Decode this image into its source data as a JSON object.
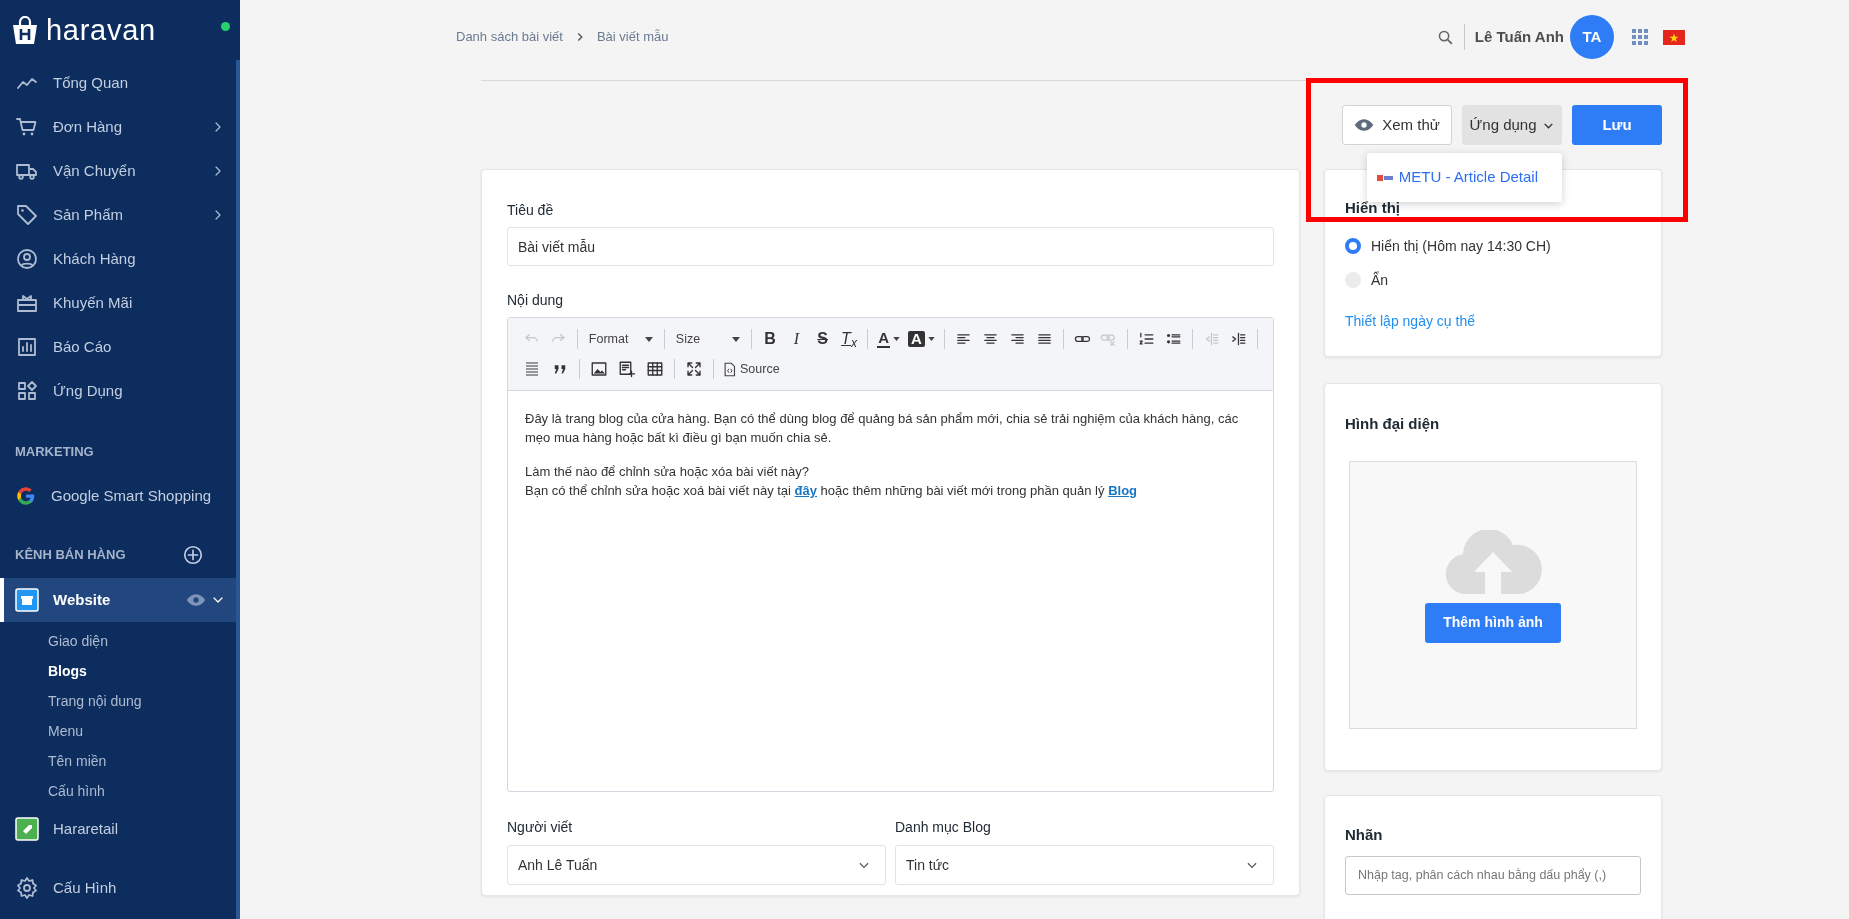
{
  "sidebar": {
    "logo_text": "haravan",
    "online": true,
    "nav_items": [
      {
        "label": "Tổng Quan",
        "has_submenu": false
      },
      {
        "label": "Đơn Hàng",
        "has_submenu": true
      },
      {
        "label": "Vận Chuyển",
        "has_submenu": true
      },
      {
        "label": "Sản Phẩm",
        "has_submenu": true
      },
      {
        "label": "Khách Hàng",
        "has_submenu": false
      },
      {
        "label": "Khuyến Mãi",
        "has_submenu": false
      },
      {
        "label": "Báo Cáo",
        "has_submenu": false
      },
      {
        "label": "Ứng Dụng",
        "has_submenu": false
      }
    ],
    "marketing": {
      "heading": "MARKETING",
      "items": [
        {
          "label": "Google Smart Shopping"
        }
      ]
    },
    "sales_channels": {
      "heading": "KÊNH BÁN HÀNG",
      "channels": [
        {
          "label": "Website",
          "selected": true,
          "expanded": true,
          "children": [
            {
              "label": "Giao diện",
              "selected": false
            },
            {
              "label": "Blogs",
              "selected": true
            },
            {
              "label": "Trang nội dung",
              "selected": false
            },
            {
              "label": "Menu",
              "selected": false
            },
            {
              "label": "Tên miền",
              "selected": false
            },
            {
              "label": "Cấu hình",
              "selected": false
            }
          ]
        },
        {
          "label": "Hararetail",
          "selected": false,
          "expanded": false
        }
      ]
    },
    "footer_item": {
      "label": "Cấu Hình"
    }
  },
  "header": {
    "breadcrumb": [
      "Danh sách bài viết",
      "Bài viết mẫu"
    ],
    "user_name": "Lê Tuấn Anh",
    "avatar_initials": "TA"
  },
  "actions": {
    "preview_button": "Xem thử",
    "apps_button": "Ứng dụng",
    "save_button": "Lưu",
    "apps_menu": {
      "open": true,
      "items": [
        {
          "label": "METU - Article Detail"
        }
      ]
    }
  },
  "article": {
    "title_label": "Tiêu đề",
    "title_value": "Bài viết mẫu",
    "content_label": "Nội dung",
    "toolbar_rows": [
      [
        {
          "kind": "icon",
          "disabled": true
        },
        {
          "kind": "icon",
          "disabled": true
        },
        {
          "kind": "separator"
        },
        {
          "kind": "menu",
          "label": "Format"
        },
        {
          "kind": "separator"
        },
        {
          "kind": "menu",
          "label": "Size"
        },
        {
          "kind": "separator"
        },
        {
          "kind": "bold",
          "label": "B"
        },
        {
          "kind": "italic",
          "label": "I"
        },
        {
          "kind": "strike",
          "label": "S"
        },
        {
          "kind": "clear_format",
          "label": "T$_{x}$"
        },
        {
          "kind": "separator"
        },
        {
          "kind": "color_menu",
          "label": "A"
        },
        {
          "kind": "highlight_menu",
          "label": "A"
        },
        {
          "kind": "separator"
        },
        {
          "kind": "icon",
          "disabled": false
        },
        {
          "kind": "icon",
          "disabled": false
        },
        {
          "kind": "icon",
          "disabled": false
        },
        {
          "kind": "icon",
          "disabled": false
        },
        {
          "kind": "separator"
        },
        {
          "kind": "icon",
          "disabled": false
        },
        {
          "kind": "icon",
          "disabled": true
        },
        {
          "kind": "separator"
        },
        {
          "kind": "icon",
          "disabled": false
        },
        {
          "kind": "icon",
          "disabled": false
        },
        {
          "kind": "separator"
        },
        {
          "kind": "icon",
          "disabled": true
        },
        {
          "kind": "icon",
          "disabled": false
        },
        {
          "kind": "separator"
        }
      ],
      [
        {
          "kind": "icon",
          "disabled": false
        },
        {
          "kind": "icon",
          "disabled": false
        },
        {
          "kind": "separator"
        },
        {
          "kind": "icon",
          "disabled": false
        },
        {
          "kind": "icon",
          "disabled": false
        },
        {
          "kind": "icon",
          "disabled": false
        },
        {
          "kind": "separator"
        },
        {
          "kind": "icon",
          "disabled": false
        },
        {
          "kind": "separator"
        },
        {
          "kind": "source",
          "label": "Source"
        }
      ]
    ],
    "content": [
      {
        "lines": [
          [
            {
              "text": "Đây là trang blog của cửa hàng. Bạn có thể dùng blog để quảng bá sản phẩm mới, chia sẻ trải nghiệm của khách hàng, các mẹo mua hàng hoặc bất kì điều gì bạn muốn chia sẻ.",
              "link": false
            }
          ]
        ]
      },
      {
        "lines": [
          [
            {
              "text": "Làm thế nào để chỉnh sửa hoặc xóa bài viết này?",
              "link": false
            }
          ],
          [
            {
              "text": "Bạn có thể chỉnh sửa hoặc xoá bài viết này tại ",
              "link": false
            },
            {
              "text": "đây",
              "link": true
            },
            {
              "text": " hoặc thêm những bài viết mới trong phần quản lý ",
              "link": false
            },
            {
              "text": "Blog",
              "link": true
            }
          ]
        ]
      }
    ],
    "author": {
      "label": "Người viết",
      "value": "Anh Lê Tuấn"
    },
    "category": {
      "label": "Danh mục Blog",
      "value": "Tin tức"
    }
  },
  "visibility": {
    "title": "Hiển thị",
    "options": [
      {
        "label": "Hiển thị (Hôm nay 14:30 CH)",
        "selected": true
      },
      {
        "label": "Ẩn",
        "selected": false
      }
    ],
    "schedule_link": "Thiết lập ngày cụ thể"
  },
  "featured_image": {
    "title": "Hình đại diện",
    "upload_button": "Thêm hình ảnh"
  },
  "tags": {
    "title": "Nhãn",
    "placeholder": "Nhập tag, phân cách nhau bằng dấu phẩy (,)"
  }
}
